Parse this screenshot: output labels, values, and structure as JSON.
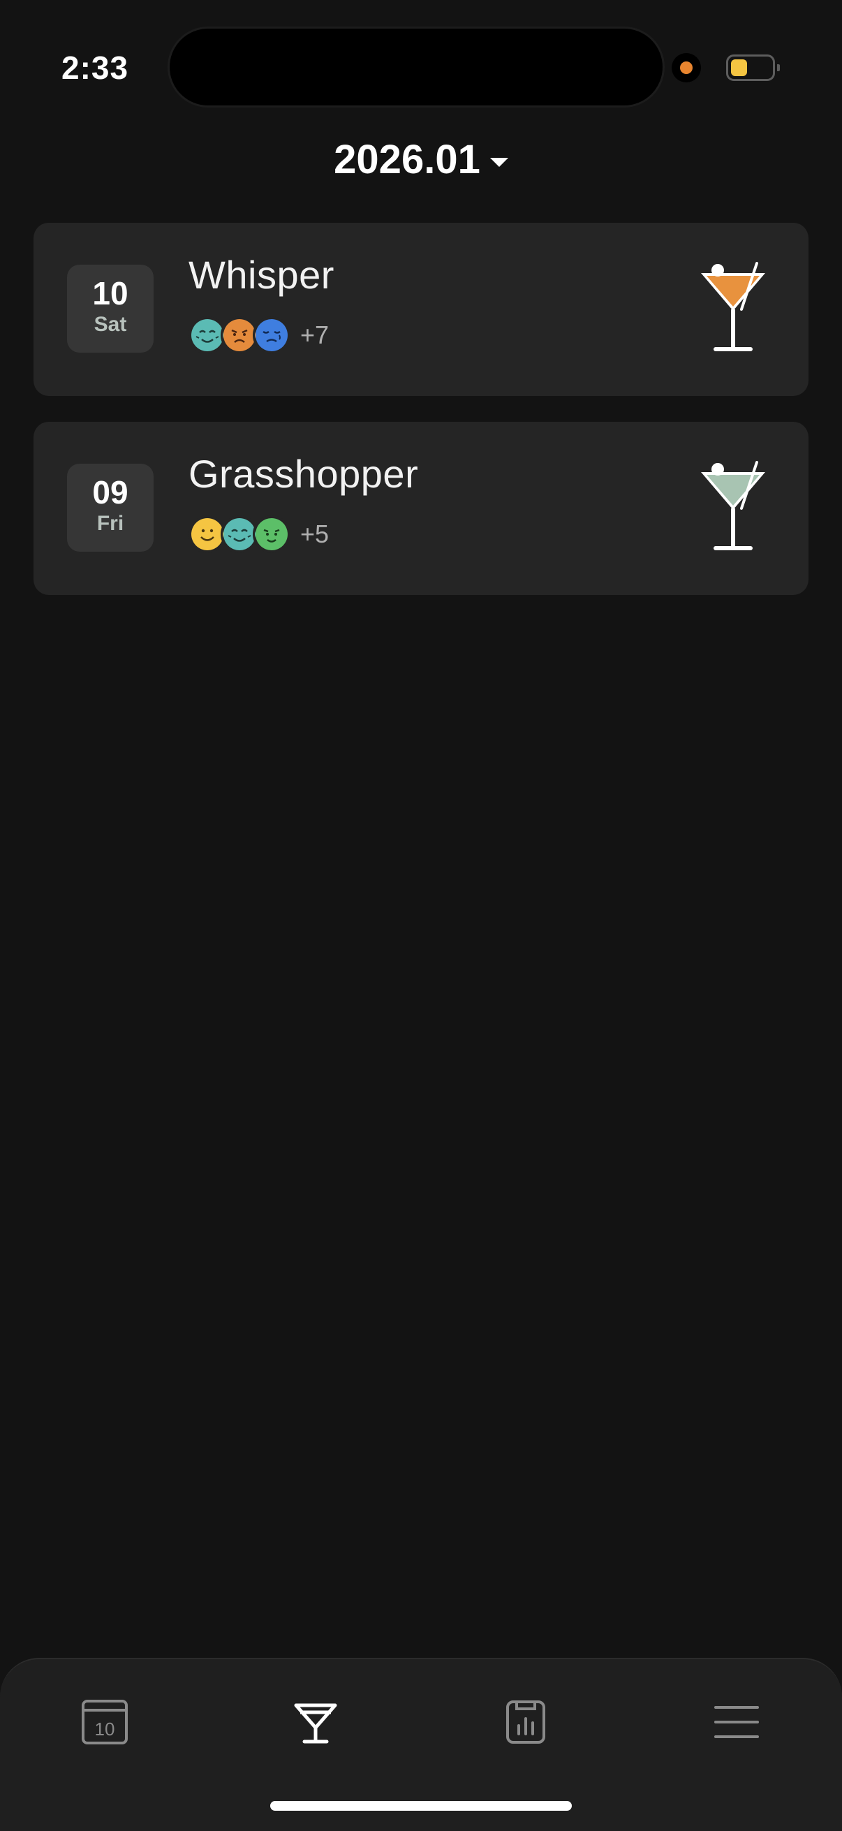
{
  "status_bar": {
    "time": "2:33",
    "battery_level": 0.4
  },
  "header": {
    "month": "2026.01"
  },
  "entries": [
    {
      "day": "10",
      "weekday": "Sat",
      "name": "Whisper",
      "moods": [
        "calm-teal",
        "grumpy-orange",
        "sad-blue"
      ],
      "more": "+7",
      "liquid_color": "#e8923e"
    },
    {
      "day": "09",
      "weekday": "Fri",
      "name": "Grasshopper",
      "moods": [
        "happy-yellow",
        "calm-teal",
        "content-green"
      ],
      "more": "+5",
      "liquid_color": "#a8c4b2"
    }
  ],
  "tabbar": {
    "tabs": [
      {
        "icon": "calendar-icon",
        "label": "10",
        "active": false
      },
      {
        "icon": "cocktail-icon",
        "active": true
      },
      {
        "icon": "stats-icon",
        "active": false
      },
      {
        "icon": "menu-icon",
        "active": false
      }
    ]
  },
  "colors": {
    "background": "#131313",
    "card": "#252525",
    "date_box": "#363636",
    "tabbar": "#1f1f1f"
  }
}
